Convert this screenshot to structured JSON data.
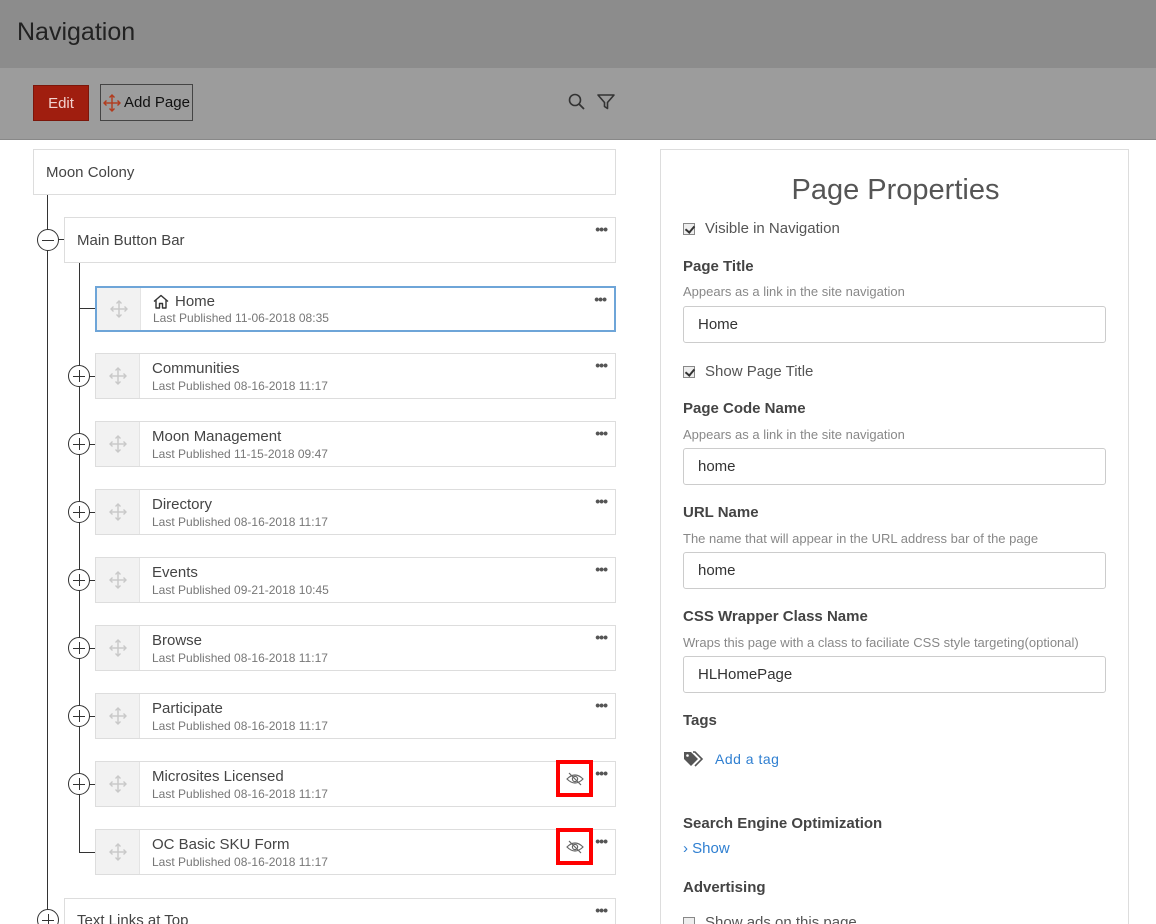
{
  "header": {
    "title": "Navigation"
  },
  "toolbar": {
    "edit_label": "Edit",
    "add_page_label": "Add Page"
  },
  "tree": {
    "root": "Moon Colony",
    "groups": [
      {
        "label": "Main Button Bar"
      },
      {
        "label": "Text Links at Top"
      }
    ],
    "pages": [
      {
        "name": "Home",
        "published": "Last Published 11-06-2018 08:35"
      },
      {
        "name": "Communities",
        "published": "Last Published 08-16-2018 11:17"
      },
      {
        "name": "Moon Management",
        "published": "Last Published 11-15-2018 09:47"
      },
      {
        "name": "Directory",
        "published": "Last Published 08-16-2018 11:17"
      },
      {
        "name": "Events",
        "published": "Last Published 09-21-2018 10:45"
      },
      {
        "name": "Browse",
        "published": "Last Published 08-16-2018 11:17"
      },
      {
        "name": "Participate",
        "published": "Last Published 08-16-2018 11:17"
      },
      {
        "name": "Microsites Licensed",
        "published": "Last Published 08-16-2018 11:17"
      },
      {
        "name": "OC Basic SKU Form",
        "published": "Last Published 08-16-2018 11:17"
      }
    ],
    "menu_glyph": "•••"
  },
  "properties": {
    "title": "Page Properties",
    "visible_in_navigation": "Visible in Navigation",
    "page_title_label": "Page Title",
    "page_title_help": "Appears as a link in the site navigation",
    "page_title_value": "Home",
    "show_page_title": "Show Page Title",
    "code_name_label": "Page Code Name",
    "code_name_help": "Appears as a link in the site navigation",
    "code_name_value": "home",
    "url_name_label": "URL Name",
    "url_name_help": "The name that will appear in the URL address bar of the page",
    "url_name_value": "home",
    "css_label": "CSS Wrapper Class Name",
    "css_help": "Wraps this page with a class to faciliate CSS style targeting(optional)",
    "css_value": "HLHomePage",
    "tags_label": "Tags",
    "add_tag": "Add a tag",
    "seo_label": "Search Engine Optimization",
    "seo_show": "› Show",
    "advertising_label": "Advertising",
    "show_ads": "Show ads on this page"
  },
  "colors": {
    "edit_button": "#a01e0f",
    "selected_border": "#6ea5d8",
    "link": "#2f7fd1",
    "flag": "#ff0000"
  },
  "icons": [
    "move-icon",
    "search-icon",
    "filter-icon",
    "home-icon",
    "drag-handle-icon",
    "eye-off-icon",
    "tag-icon"
  ]
}
